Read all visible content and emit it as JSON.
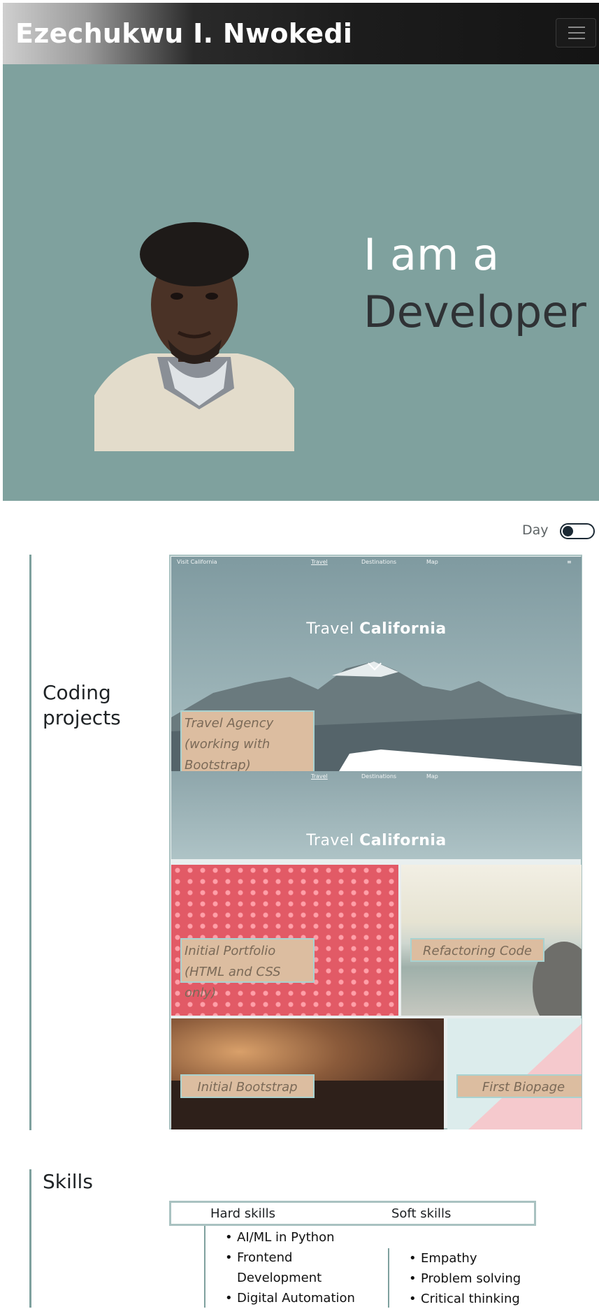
{
  "navbar": {
    "brand": "Ezechukwu I. Nwokedi",
    "toggler_icon": "hamburger-icon"
  },
  "hero": {
    "line1": "I am a",
    "line2": "Developer",
    "bg_color": "#7fa19e"
  },
  "theme_toggle": {
    "label": "Day",
    "state": "off"
  },
  "projects": {
    "title": "Coding projects",
    "items": [
      {
        "caption": "Travel Agency (working with Bootstrap)"
      },
      {
        "caption": "Initial Portfolio (HTML and CSS only)"
      },
      {
        "caption": "Refactoring Code"
      },
      {
        "caption": "Initial Bootstrap"
      },
      {
        "caption": "First Biopage"
      }
    ],
    "preview": {
      "brand": "Visit California",
      "nav": [
        "Travel",
        "Destinations",
        "Map"
      ],
      "headline_light": "Travel",
      "headline_bold": "California"
    }
  },
  "skills": {
    "title": "Skills",
    "headers": [
      "Hard skills",
      "Soft skills"
    ],
    "hard": [
      "AI/ML in Python",
      "Frontend Development",
      "Digital Automation"
    ],
    "soft": [
      "Empathy",
      "Problem solving",
      "Critical thinking"
    ]
  }
}
